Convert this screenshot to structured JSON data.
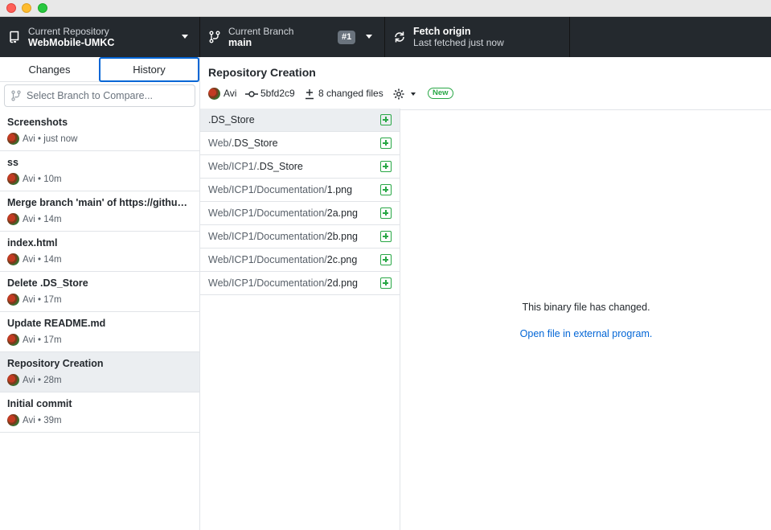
{
  "toolbar": {
    "repo": {
      "label": "Current Repository",
      "value": "WebMobile-UMKC"
    },
    "branch": {
      "label": "Current Branch",
      "value": "main",
      "pr_badge": "#1"
    },
    "fetch": {
      "label": "Fetch origin",
      "sublabel": "Last fetched just now"
    }
  },
  "sidebar": {
    "tabs": [
      {
        "label": "Changes"
      },
      {
        "label": "History"
      }
    ],
    "compare_placeholder": "Select Branch to Compare...",
    "commits": [
      {
        "title": "Screenshots",
        "author": "Avi",
        "time": "just now"
      },
      {
        "title": "ss",
        "author": "Avi",
        "time": "10m"
      },
      {
        "title": "Merge branch 'main' of https://github.com/Avi/WebMobile-UMKC",
        "author": "Avi",
        "time": "14m"
      },
      {
        "title": "index.html",
        "author": "Avi",
        "time": "14m"
      },
      {
        "title": "Delete .DS_Store",
        "author": "Avi",
        "time": "17m"
      },
      {
        "title": "Update README.md",
        "author": "Avi",
        "time": "17m"
      },
      {
        "title": "Repository Creation",
        "author": "Avi",
        "time": "28m",
        "selected": true
      },
      {
        "title": "Initial commit",
        "author": "Avi",
        "time": "39m"
      }
    ]
  },
  "commit_detail": {
    "title": "Repository Creation",
    "author": "Avi",
    "sha": "5bfd2c9",
    "changed_files": "8 changed files",
    "new_badge": "New"
  },
  "files": [
    {
      "dir": "",
      "name": ".DS_Store",
      "selected": true
    },
    {
      "dir": "Web/",
      "name": ".DS_Store"
    },
    {
      "dir": "Web/ICP1/",
      "name": ".DS_Store"
    },
    {
      "dir": "Web/ICP1/Documentation/",
      "name": "1.png"
    },
    {
      "dir": "Web/ICP1/Documentation/",
      "name": "2a.png"
    },
    {
      "dir": "Web/ICP1/Documentation/",
      "name": "2b.png"
    },
    {
      "dir": "Web/ICP1/Documentation/",
      "name": "2c.png"
    },
    {
      "dir": "Web/ICP1/Documentation/",
      "name": "2d.png"
    }
  ],
  "diff": {
    "message": "This binary file has changed.",
    "link": "Open file in external program."
  }
}
